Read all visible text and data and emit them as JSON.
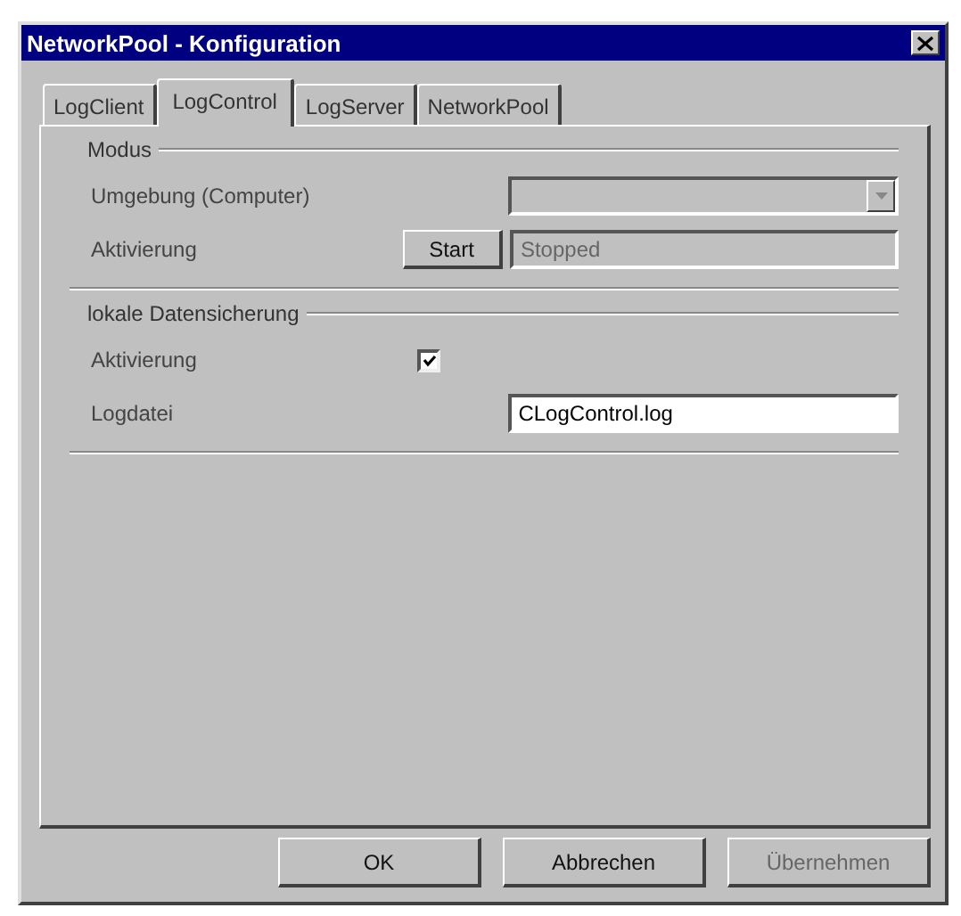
{
  "window": {
    "title": "NetworkPool - Konfiguration"
  },
  "tabs": [
    {
      "label": "LogClient",
      "selected": false
    },
    {
      "label": "LogControl",
      "selected": true
    },
    {
      "label": "LogServer",
      "selected": false
    },
    {
      "label": "NetworkPool",
      "selected": false
    }
  ],
  "modus": {
    "heading": "Modus",
    "environment_label": "Umgebung (Computer)",
    "environment_disabled": true,
    "activation_label": "Aktivierung",
    "start_button": "Start",
    "status_value": "Stopped",
    "status_disabled": true
  },
  "local_backup": {
    "heading": "lokale Datensicherung",
    "activation_label": "Aktivierung",
    "activation_checked": true,
    "logfile_label": "Logdatei",
    "logfile_value": "CLogControl.log"
  },
  "buttons": [
    {
      "label": "OK",
      "disabled": false
    },
    {
      "label": "Abbrechen",
      "disabled": false
    },
    {
      "label": "Übernehmen",
      "disabled": true
    }
  ]
}
